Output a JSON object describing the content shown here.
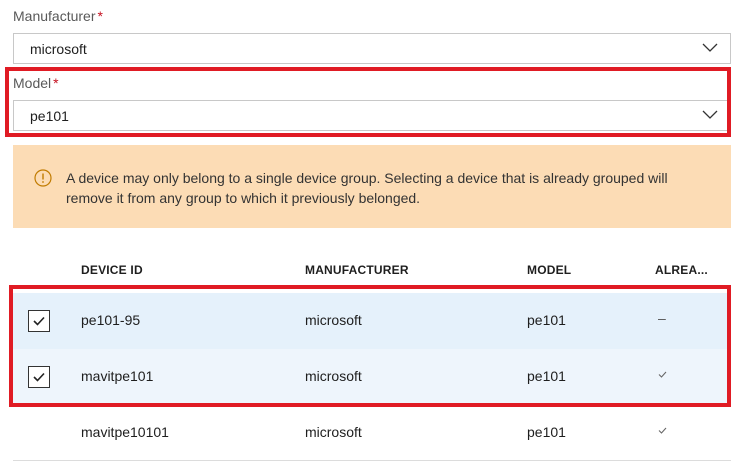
{
  "manufacturer_field": {
    "label": "Manufacturer",
    "required_mark": "*",
    "value": "microsoft"
  },
  "model_field": {
    "label": "Model",
    "required_mark": "*",
    "value": "pe101"
  },
  "warning": {
    "text": "A device may only belong to a single device group. Selecting a device that is already grouped will remove it from any group to which it previously belonged.",
    "icon": "info-icon",
    "background_color": "#fcdcb5"
  },
  "table": {
    "columns": [
      "DEVICE ID",
      "MANUFACTURER",
      "MODEL",
      "ALREA..."
    ],
    "rows": [
      {
        "checked": true,
        "device_id": "pe101-95",
        "manufacturer": "microsoft",
        "model": "pe101",
        "already_status": "–"
      },
      {
        "checked": true,
        "device_id": "mavitpe101",
        "manufacturer": "microsoft",
        "model": "pe101",
        "already_status": "check"
      },
      {
        "checked": false,
        "device_id": "mavitpe10101",
        "manufacturer": "microsoft",
        "model": "pe101",
        "already_status": "check"
      }
    ]
  },
  "highlight_color": "#e01b24"
}
